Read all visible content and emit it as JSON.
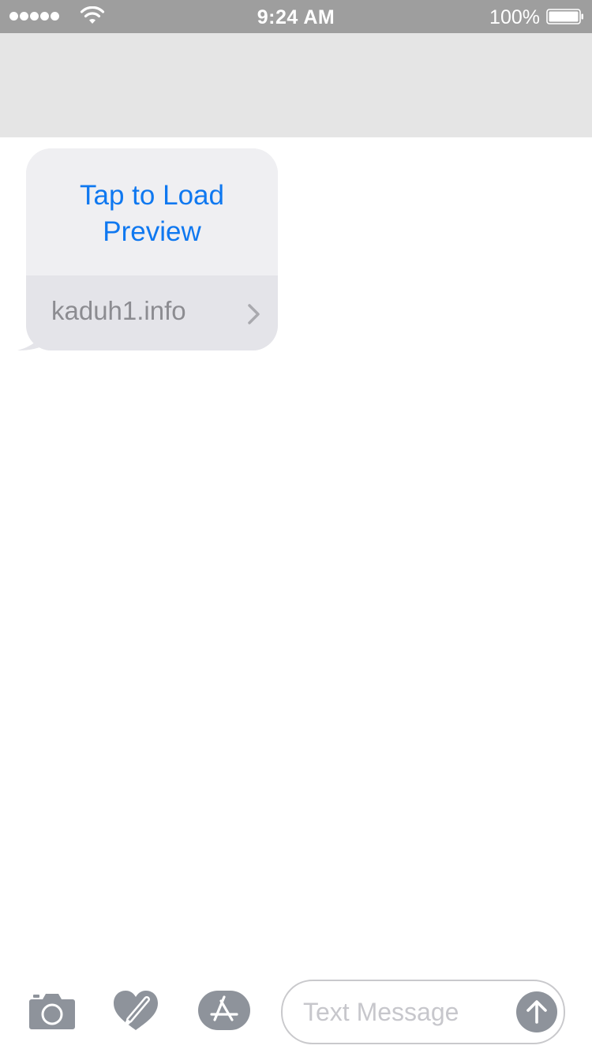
{
  "status_bar": {
    "time": "9:24 AM",
    "battery_percent": "100%",
    "signal_bars": 5,
    "battery_level": 1.0
  },
  "message": {
    "preview_label": "Tap to Load Preview",
    "link_domain": "kaduh1.info"
  },
  "composer": {
    "placeholder": "Text Message"
  },
  "icons": {
    "camera": "camera-icon",
    "digital_touch": "digital-touch-icon",
    "app_store": "app-store-icon",
    "send": "arrow-up-icon"
  },
  "colors": {
    "link_blue": "#0f78f0",
    "status_bar_bg": "#9e9e9e",
    "header_bg": "#e5e5e5",
    "icon_gray": "#8e939b"
  }
}
